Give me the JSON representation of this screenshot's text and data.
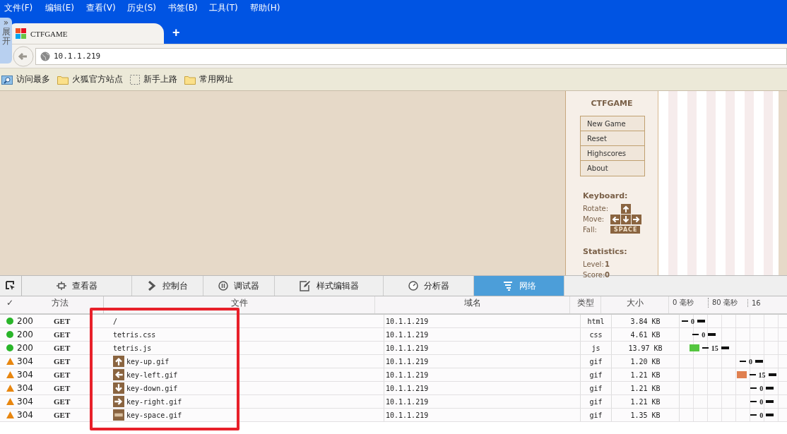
{
  "menu_bar": [
    "文件(F)",
    "编辑(E)",
    "查看(V)",
    "历史(S)",
    "书签(B)",
    "工具(T)",
    "帮助(H)"
  ],
  "sidebar_toggle": {
    "arrow": "»",
    "label": "展开"
  },
  "tabs": [
    {
      "title": "CTFGAME",
      "selected": true
    }
  ],
  "new_tab": "+",
  "address_bar": {
    "value": "10.1.1.219"
  },
  "bookmarks": [
    {
      "label": "访问最多",
      "kind": "smart"
    },
    {
      "label": "火狐官方站点",
      "kind": "folder"
    },
    {
      "label": "新手上路",
      "kind": "dashed"
    },
    {
      "label": "常用网址",
      "kind": "folder"
    }
  ],
  "game": {
    "title": "CTFGAME",
    "menu": [
      "New Game",
      "Reset",
      "Highscores",
      "About"
    ],
    "keyboard_heading": "Keyboard:",
    "rotate": "Rotate:",
    "move": "Move:",
    "fall": "Fall:",
    "space_key": "SPACE",
    "statistics_heading": "Statistics:",
    "stats": [
      {
        "label": "Level:",
        "value": "1"
      },
      {
        "label": "Score:",
        "value": "0"
      }
    ]
  },
  "devtools": {
    "tabs": [
      {
        "label": "查看器",
        "kind": "inspector",
        "selected": false
      },
      {
        "label": "控制台",
        "kind": "console",
        "selected": false
      },
      {
        "label": "调试器",
        "kind": "debugger",
        "selected": false
      },
      {
        "label": "样式编辑器",
        "kind": "style",
        "selected": false
      },
      {
        "label": "分析器",
        "kind": "profiler",
        "selected": false
      },
      {
        "label": "网络",
        "kind": "network",
        "selected": true
      }
    ],
    "columns": [
      "✓",
      "方法",
      "文件",
      "域名",
      "类型",
      "大小"
    ],
    "timeline_ticks": [
      "0 毫秒",
      "80 毫秒",
      "16"
    ],
    "rows": [
      {
        "status": "200",
        "kind": "ok",
        "method": "GET",
        "file": "/",
        "thumbnail": false,
        "domain": "10.1.1.219",
        "type": "html",
        "size": "3.84 KB",
        "timing": {
          "level": 0.02,
          "duration": "0"
        }
      },
      {
        "status": "200",
        "kind": "ok",
        "method": "GET",
        "file": "tetris.css",
        "thumbnail": false,
        "domain": "10.1.1.219",
        "type": "css",
        "size": "4.61 KB",
        "timing": {
          "level": 0.12,
          "duration": "0"
        }
      },
      {
        "status": "200",
        "kind": "ok",
        "method": "GET",
        "file": "tetris.js",
        "thumbnail": false,
        "domain": "10.1.1.219",
        "type": "js",
        "size": "13.97 KB",
        "timing": {
          "level": 0.09,
          "duration": "15",
          "color": "#55c640"
        }
      },
      {
        "status": "304",
        "kind": "cached",
        "method": "GET",
        "file": "key-up.gif",
        "thumbnail": true,
        "domain": "10.1.1.219",
        "type": "gif",
        "size": "1.20 KB",
        "timing": {
          "level": 0.56,
          "duration": "0"
        }
      },
      {
        "status": "304",
        "kind": "cached",
        "method": "GET",
        "file": "key-left.gif",
        "thumbnail": true,
        "domain": "10.1.1.219",
        "type": "gif",
        "size": "1.21 KB",
        "timing": {
          "level": 0.53,
          "duration": "15",
          "color": "#e08050"
        }
      },
      {
        "status": "304",
        "kind": "cached",
        "method": "GET",
        "file": "key-down.gif",
        "thumbnail": true,
        "domain": "10.1.1.219",
        "type": "gif",
        "size": "1.21 KB",
        "timing": {
          "level": 0.66,
          "duration": "0"
        }
      },
      {
        "status": "304",
        "kind": "cached",
        "method": "GET",
        "file": "key-right.gif",
        "thumbnail": true,
        "domain": "10.1.1.219",
        "type": "gif",
        "size": "1.21 KB",
        "timing": {
          "level": 0.66,
          "duration": "0"
        }
      },
      {
        "status": "304",
        "kind": "cached",
        "method": "GET",
        "file": "key-space.gif",
        "thumbnail": true,
        "domain": "10.1.1.219",
        "type": "gif",
        "size": "1.35 KB",
        "timing": {
          "level": 0.66,
          "duration": "0"
        }
      }
    ]
  }
}
